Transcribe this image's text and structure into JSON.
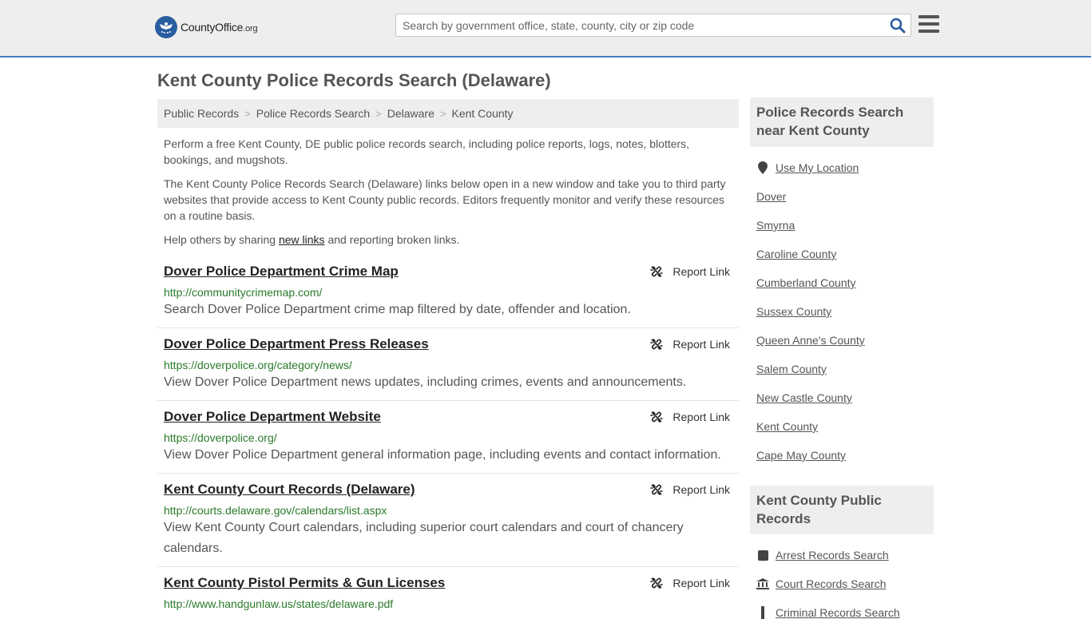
{
  "header": {
    "logo_text": "CountyOffice",
    "logo_suffix": ".org",
    "search_placeholder": "Search by government office, state, county, city or zip code"
  },
  "page_title": "Kent County Police Records Search (Delaware)",
  "breadcrumb": [
    "Public Records",
    "Police Records Search",
    "Delaware",
    "Kent County"
  ],
  "intro": {
    "p1": "Perform a free Kent County, DE public police records search, including police reports, logs, notes, blotters, bookings, and mugshots.",
    "p2": "The Kent County Police Records Search (Delaware) links below open in a new window and take you to third party websites that provide access to Kent County public records. Editors frequently monitor and verify these resources on a routine basis.",
    "p3_before": "Help others by sharing ",
    "p3_link": "new links",
    "p3_after": " and reporting broken links."
  },
  "report_label": "Report Link",
  "results": [
    {
      "title": "Dover Police Department Crime Map",
      "url": "http://communitycrimemap.com/",
      "desc": "Search Dover Police Department crime map filtered by date, offender and location."
    },
    {
      "title": "Dover Police Department Press Releases",
      "url": "https://doverpolice.org/category/news/",
      "desc": "View Dover Police Department news updates, including crimes, events and announcements."
    },
    {
      "title": "Dover Police Department Website",
      "url": "https://doverpolice.org/",
      "desc": "View Dover Police Department general information page, including events and contact information."
    },
    {
      "title": "Kent County Court Records (Delaware)",
      "url": "http://courts.delaware.gov/calendars/list.aspx",
      "desc": "View Kent County Court calendars, including superior court calendars and court of chancery calendars."
    },
    {
      "title": "Kent County Pistol Permits & Gun Licenses",
      "url": "http://www.handgunlaw.us/states/delaware.pdf",
      "desc": ""
    }
  ],
  "sidebar": {
    "near_title": "Police Records Search near Kent County",
    "use_location": "Use My Location",
    "near_links": [
      "Dover",
      "Smyrna",
      "Caroline County",
      "Cumberland County",
      "Sussex County",
      "Queen Anne's County",
      "Salem County",
      "New Castle County",
      "Kent County",
      "Cape May County"
    ],
    "public_title": "Kent County Public Records",
    "public_links": [
      "Arrest Records Search",
      "Court Records Search",
      "Criminal Records Search"
    ]
  },
  "colors": {
    "accent": "#3f7cbf",
    "url_green": "#2a7a2a",
    "panel_gray": "#eeeeee"
  }
}
